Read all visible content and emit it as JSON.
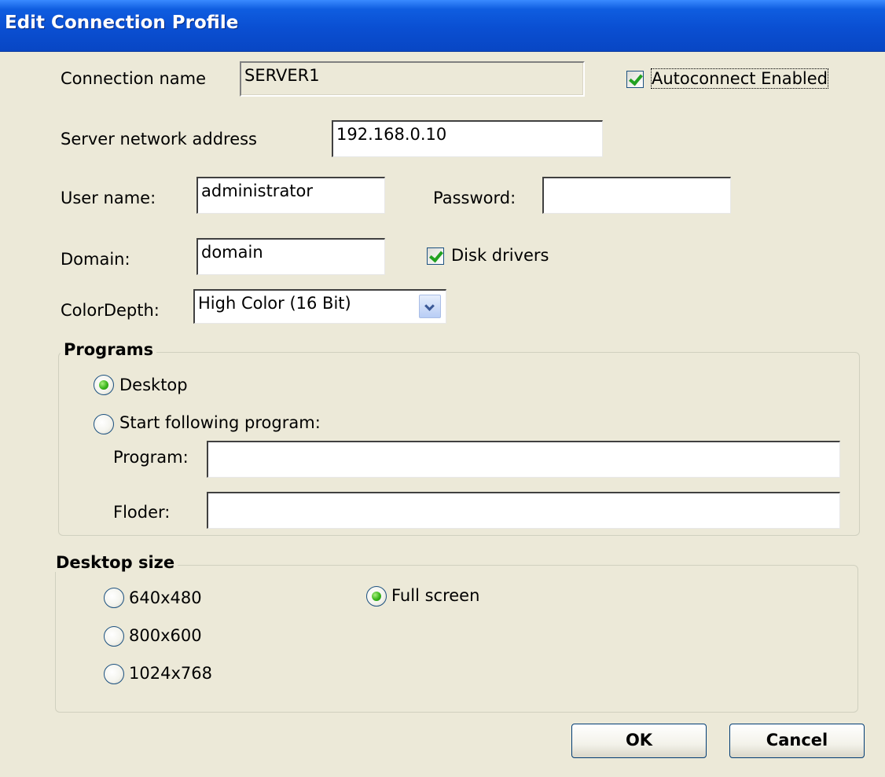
{
  "window": {
    "title": "Edit Connection Profile"
  },
  "connection": {
    "label": "Connection name",
    "value": "SERVER1"
  },
  "autoconnect": {
    "label": "Autoconnect Enabled",
    "checked": true
  },
  "server": {
    "label": "Server network address",
    "value": "192.168.0.10"
  },
  "user": {
    "label": "User name:",
    "value": "administrator"
  },
  "password": {
    "label": "Password:",
    "value": ""
  },
  "domain": {
    "label": "Domain:",
    "value": "domain"
  },
  "disk_drivers": {
    "label": "Disk drivers",
    "checked": true
  },
  "color_depth": {
    "label": "ColorDepth:",
    "value": "High Color (16 Bit)"
  },
  "programs": {
    "title": "Programs",
    "desktop_label": "Desktop",
    "start_label": "Start following program:",
    "selected": "Desktop",
    "program_label": "Program:",
    "program_value": "",
    "folder_label": "Floder:",
    "folder_value": ""
  },
  "desktop_size": {
    "title": "Desktop size",
    "options": [
      "640x480",
      "800x600",
      "1024x768",
      "Full screen"
    ],
    "selected": "Full screen"
  },
  "buttons": {
    "ok": "OK",
    "cancel": "Cancel"
  },
  "colors": {
    "title_bar": "#0a4fd2",
    "dialog_bg": "#ece9d8",
    "radio_selected": "#39b51a",
    "check_mark": "#21a121"
  },
  "icons": [
    "check-icon",
    "radio-selected-icon",
    "chevron-down-icon"
  ]
}
